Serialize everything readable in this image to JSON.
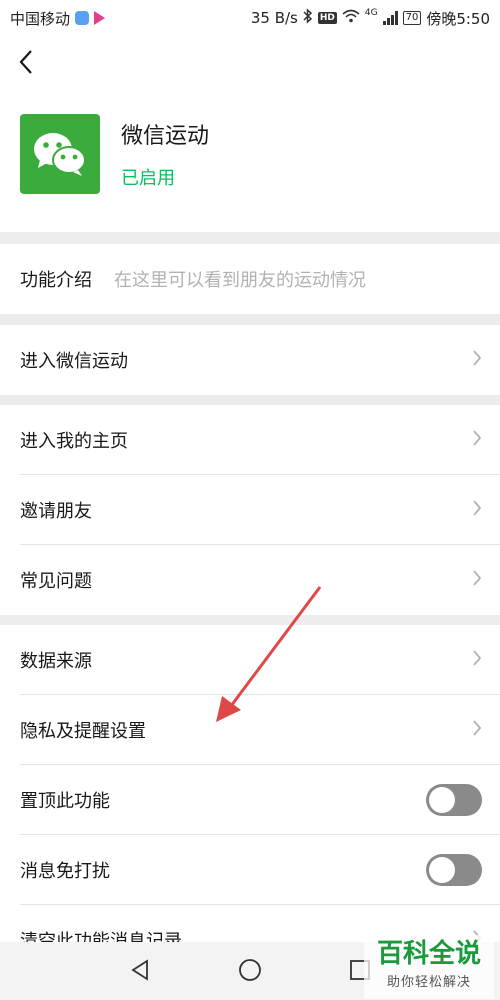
{
  "status_bar": {
    "carrier": "中国移动",
    "speed": "35 B/s",
    "hd": "HD",
    "network": "4G",
    "battery": "70",
    "time": "傍晚5:50"
  },
  "header": {
    "back_icon": "chevron-left-icon",
    "app_icon": "wechat-logo-icon",
    "app_name": "微信运动",
    "app_status": "已启用",
    "accent_color": "#07c160"
  },
  "intro": {
    "label": "功能介绍",
    "description": "在这里可以看到朋友的运动情况"
  },
  "menu": {
    "enter_sport": "进入微信运动",
    "my_homepage": "进入我的主页",
    "invite_friends": "邀请朋友",
    "faq": "常见问题",
    "data_source": "数据来源",
    "privacy_settings": "隐私及提醒设置",
    "pin_feature": "置顶此功能",
    "mute_messages": "消息免打扰",
    "clear_history": "清空此功能消息记录"
  },
  "toggles": {
    "pin_feature_on": false,
    "mute_messages_on": false
  },
  "watermark": {
    "title": "百科全说",
    "subtitle": "助你轻松解决"
  }
}
